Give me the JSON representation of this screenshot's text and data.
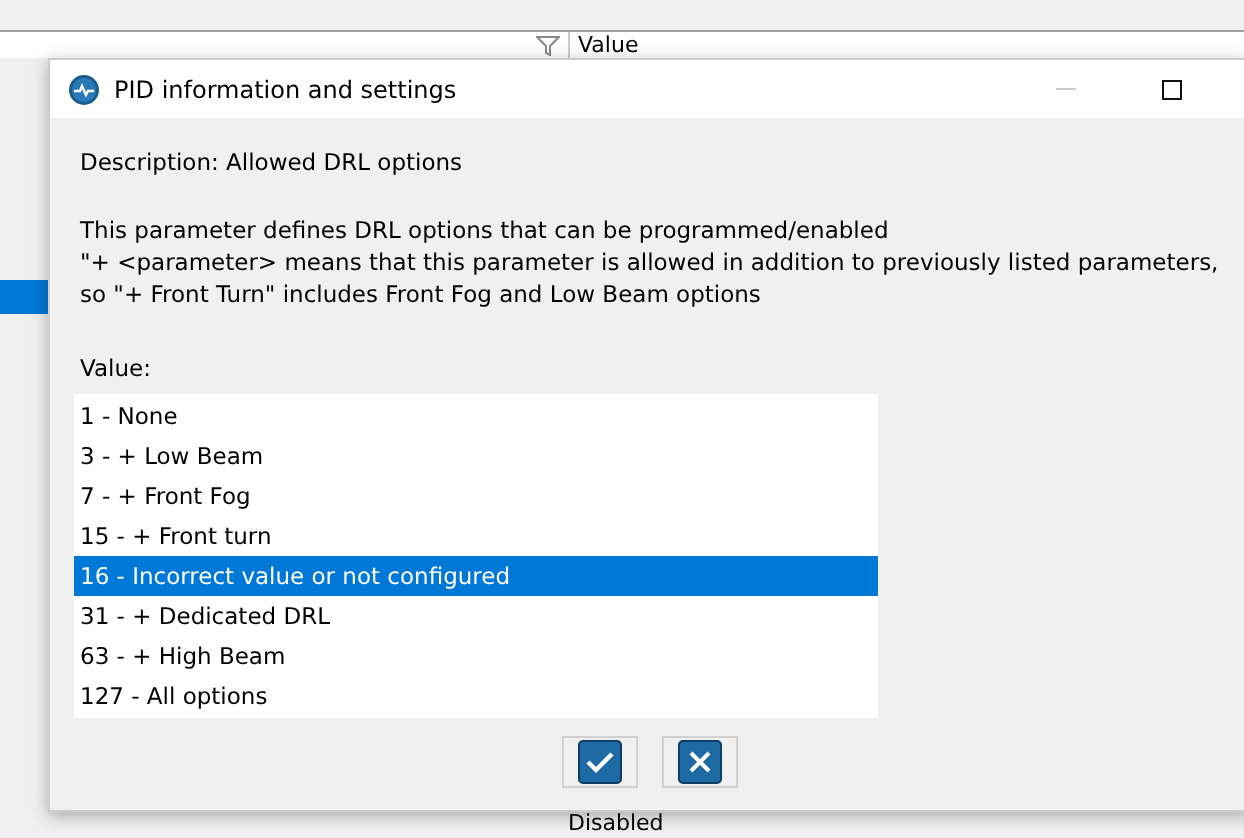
{
  "background": {
    "header": "Value",
    "status_text": "Disabled"
  },
  "dialog": {
    "title": "PID information and settings",
    "description": "Description: Allowed DRL options",
    "paragraph": [
      "This parameter defines DRL options that can be programmed/enabled",
      "\"+ <parameter> means that this parameter is allowed in addition to previously listed parameters,",
      "so \"+ Front Turn\" includes Front Fog and Low Beam options"
    ],
    "value_label": "Value:",
    "options": [
      {
        "label": "1 - None",
        "selected": false
      },
      {
        "label": "3 - + Low Beam",
        "selected": false
      },
      {
        "label": "7 - + Front Fog",
        "selected": false
      },
      {
        "label": "15 - + Front turn",
        "selected": false
      },
      {
        "label": "16 - Incorrect value or not configured",
        "selected": true
      },
      {
        "label": "31 - + Dedicated DRL",
        "selected": false
      },
      {
        "label": "63 - + High Beam",
        "selected": false
      },
      {
        "label": "127 - All options",
        "selected": false
      }
    ]
  }
}
